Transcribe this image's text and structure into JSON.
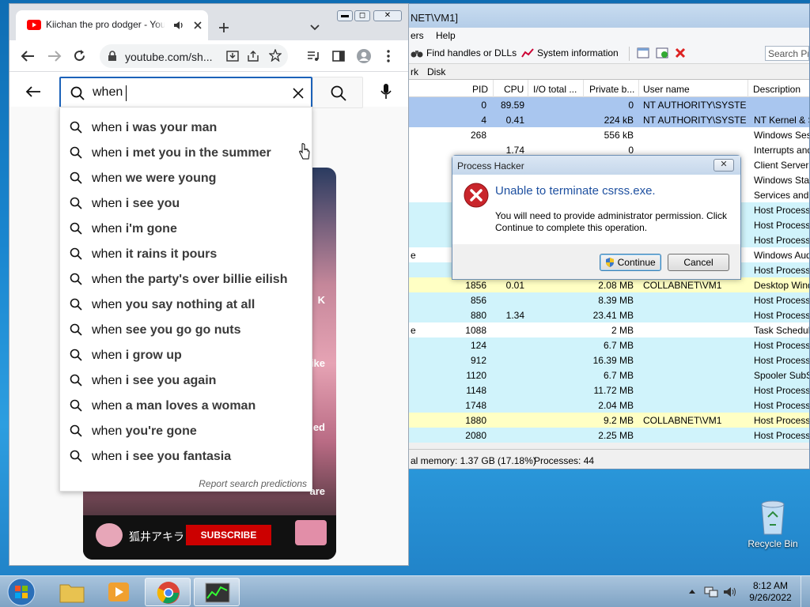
{
  "process_hacker": {
    "window_title": "NET\\VM1]",
    "menu": [
      "ers",
      "Help"
    ],
    "toolbar": {
      "handles": "Find handles or DLLs",
      "sysinfo": "System information",
      "search_placeholder": "Search Pro"
    },
    "tabs": [
      "rk",
      "Disk"
    ],
    "columns": {
      "pid": "PID",
      "cpu": "CPU",
      "io": "I/O total ...",
      "private": "Private b...",
      "user": "User name",
      "desc": "Description"
    },
    "rows": [
      {
        "name": "",
        "pid": "0",
        "cpu": "89.59",
        "io": "",
        "priv": "0",
        "user": "NT AUTHORITY\\SYSTEM",
        "desc": "",
        "color": "#a9c6ef"
      },
      {
        "name": "",
        "pid": "4",
        "cpu": "0.41",
        "io": "",
        "priv": "224 kB",
        "user": "NT AUTHORITY\\SYSTEM",
        "desc": "NT Kernel & S",
        "color": "#a9c6ef"
      },
      {
        "name": "",
        "pid": "268",
        "cpu": "",
        "io": "",
        "priv": "556 kB",
        "user": "",
        "desc": "Windows Sess",
        "color": "#ffffff"
      },
      {
        "name": "",
        "pid": "",
        "cpu": "1.74",
        "io": "",
        "priv": "0",
        "user": "",
        "desc": "Interrupts and",
        "color": "#ffffff"
      },
      {
        "name": "",
        "pid": "",
        "cpu": "",
        "io": "",
        "priv": "",
        "user": "",
        "desc": "Client Server R",
        "color": "#ffffff"
      },
      {
        "name": "",
        "pid": "",
        "cpu": "",
        "io": "",
        "priv": "",
        "user": "",
        "desc": "Windows Star",
        "color": "#ffffff"
      },
      {
        "name": "",
        "pid": "",
        "cpu": "",
        "io": "",
        "priv": "",
        "user": "",
        "desc": "Services and C",
        "color": "#ffffff"
      },
      {
        "name": "",
        "pid": "",
        "cpu": "",
        "io": "",
        "priv": "",
        "user": "",
        "desc": "Host Process f",
        "color": "#d0f3fb"
      },
      {
        "name": "",
        "pid": "",
        "cpu": "",
        "io": "",
        "priv": "",
        "user": "",
        "desc": "Host Process f",
        "color": "#d0f3fb"
      },
      {
        "name": "",
        "pid": "",
        "cpu": "",
        "io": "",
        "priv": "",
        "user": "",
        "desc": "Host Process f",
        "color": "#d0f3fb"
      },
      {
        "name": "e",
        "pid": "",
        "cpu": "",
        "io": "",
        "priv": "",
        "user": "",
        "desc": "Windows Aud",
        "color": "#ffffff"
      },
      {
        "name": "",
        "pid": "",
        "cpu": "",
        "io": "",
        "priv": "",
        "user": "",
        "desc": "Host Process f",
        "color": "#d0f3fb"
      },
      {
        "name": "",
        "pid": "1856",
        "cpu": "0.01",
        "io": "",
        "priv": "2.08 MB",
        "user": "COLLABNET\\VM1",
        "desc": "Desktop Wind",
        "color": "#ffffc4"
      },
      {
        "name": "",
        "pid": "856",
        "cpu": "",
        "io": "",
        "priv": "8.39 MB",
        "user": "",
        "desc": "Host Process f",
        "color": "#d0f3fb"
      },
      {
        "name": "",
        "pid": "880",
        "cpu": "1.34",
        "io": "",
        "priv": "23.41 MB",
        "user": "",
        "desc": "Host Process f",
        "color": "#d0f3fb"
      },
      {
        "name": "e",
        "pid": "1088",
        "cpu": "",
        "io": "",
        "priv": "2 MB",
        "user": "",
        "desc": "Task Schedule",
        "color": "#ffffff"
      },
      {
        "name": "",
        "pid": "124",
        "cpu": "",
        "io": "",
        "priv": "6.7 MB",
        "user": "",
        "desc": "Host Process f",
        "color": "#d0f3fb"
      },
      {
        "name": "",
        "pid": "912",
        "cpu": "",
        "io": "",
        "priv": "16.39 MB",
        "user": "",
        "desc": "Host Process f",
        "color": "#d0f3fb"
      },
      {
        "name": "",
        "pid": "1120",
        "cpu": "",
        "io": "",
        "priv": "6.7 MB",
        "user": "",
        "desc": "Spooler SubSy",
        "color": "#d0f3fb"
      },
      {
        "name": "",
        "pid": "1148",
        "cpu": "",
        "io": "",
        "priv": "11.72 MB",
        "user": "",
        "desc": "Host Process f",
        "color": "#d0f3fb"
      },
      {
        "name": "",
        "pid": "1748",
        "cpu": "",
        "io": "",
        "priv": "2.04 MB",
        "user": "",
        "desc": "Host Process f",
        "color": "#d0f3fb"
      },
      {
        "name": "",
        "pid": "1880",
        "cpu": "",
        "io": "",
        "priv": "9.2 MB",
        "user": "COLLABNET\\VM1",
        "desc": "Host Process f",
        "color": "#ffffc4"
      },
      {
        "name": "",
        "pid": "2080",
        "cpu": "",
        "io": "",
        "priv": "2.25 MB",
        "user": "",
        "desc": "Host Process f",
        "color": "#d0f3fb"
      }
    ],
    "status": {
      "memory": "al memory: 1.37 GB (17.18%)",
      "processes": "Processes: 44"
    }
  },
  "dialog": {
    "title": "Process Hacker",
    "heading": "Unable to terminate csrss.exe.",
    "message": "You will need to provide administrator permission. Click Continue to complete this operation.",
    "continue": "Continue",
    "cancel": "Cancel"
  },
  "chrome": {
    "tab_title": "Kiichan the pro dodger - YouTube",
    "url": "youtube.com/sh...",
    "search_query": "when",
    "suggestions": [
      {
        "prefix": "when ",
        "rest": "i was your man"
      },
      {
        "prefix": "when ",
        "rest": "i met you in the summer"
      },
      {
        "prefix": "when ",
        "rest": "we were young"
      },
      {
        "prefix": "when ",
        "rest": "i see you"
      },
      {
        "prefix": "when ",
        "rest": "i'm gone"
      },
      {
        "prefix": "when ",
        "rest": "it rains it pours"
      },
      {
        "prefix": "when ",
        "rest": "the party's over billie eilish"
      },
      {
        "prefix": "when ",
        "rest": "you say nothing at all"
      },
      {
        "prefix": "when ",
        "rest": "see you go go nuts"
      },
      {
        "prefix": "when ",
        "rest": "i grow up"
      },
      {
        "prefix": "when ",
        "rest": "i see you again"
      },
      {
        "prefix": "when ",
        "rest": "a man loves a woman"
      },
      {
        "prefix": "when ",
        "rest": "you're gone"
      },
      {
        "prefix": "when ",
        "rest": "i see you fantasia"
      }
    ],
    "report_link": "Report search predictions",
    "card": {
      "channel": "狐井アキラ",
      "subscribe": "SUBSCRIBE",
      "side1": "K",
      "side2": "ike",
      "side3": "bled",
      "side4": "are"
    }
  },
  "desktop": {
    "recycle_bin": "Recycle Bin"
  },
  "taskbar": {
    "time": "8:12 AM",
    "date": "9/26/2022"
  },
  "colors": {
    "accent": "#1c62b9",
    "youtube_red": "#ff0000",
    "subscribe_red": "#cc0000"
  }
}
